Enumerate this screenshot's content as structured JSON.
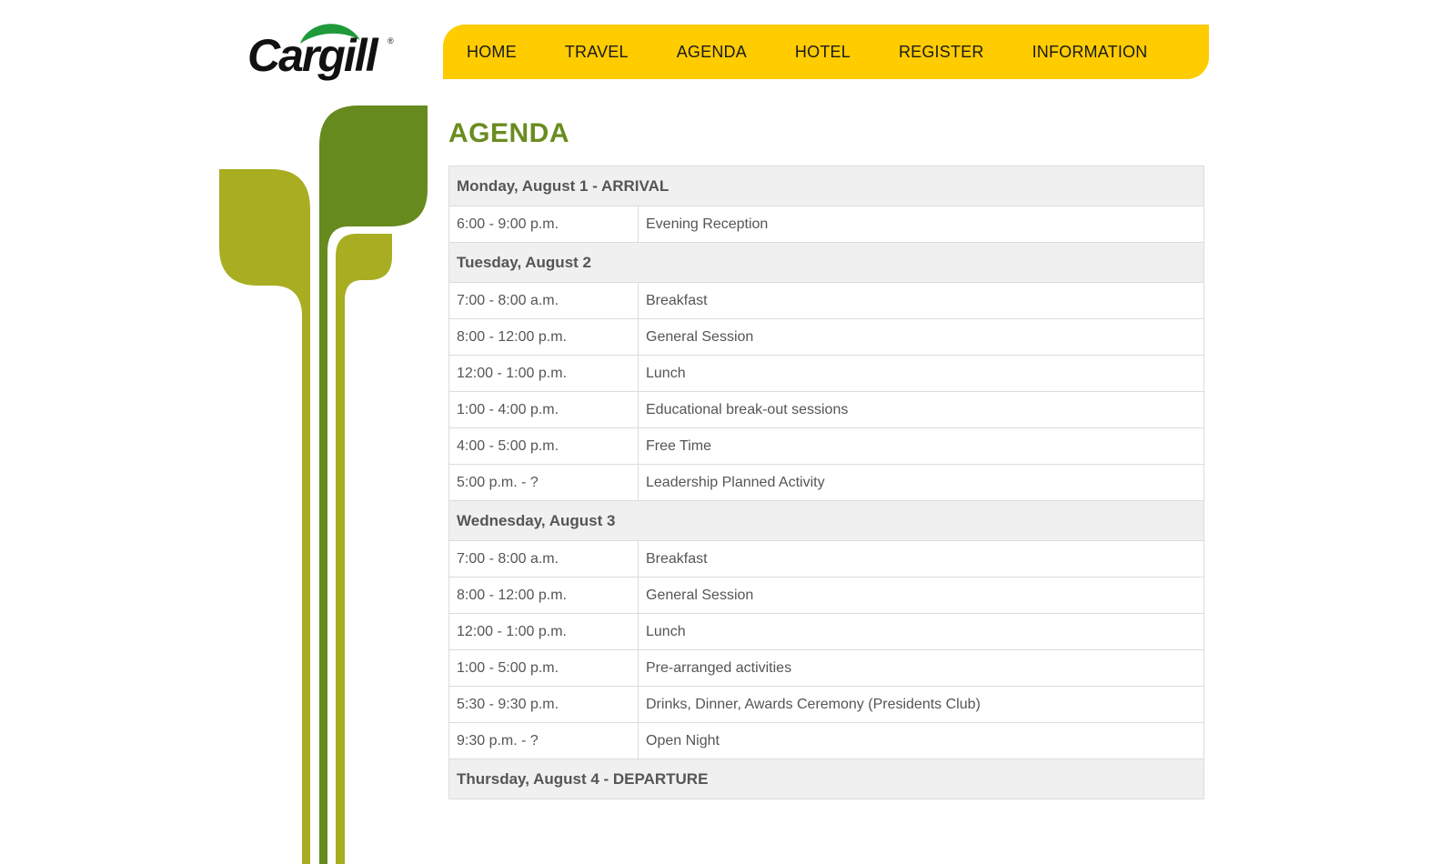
{
  "brand": {
    "logo_text": "Cargill",
    "logo_mark": "®",
    "colors": {
      "accent_yellow": "#ffcc00",
      "heading_green": "#6a8c1f",
      "leaf_olive": "#a8ad22",
      "leaf_green": "#668a1e"
    }
  },
  "nav": {
    "items": [
      {
        "label": "HOME"
      },
      {
        "label": "TRAVEL"
      },
      {
        "label": "AGENDA"
      },
      {
        "label": "HOTEL"
      },
      {
        "label": "REGISTER"
      },
      {
        "label": "INFORMATION"
      }
    ]
  },
  "main": {
    "title": "AGENDA",
    "days": [
      {
        "heading": "Monday, August 1 - ARRIVAL",
        "events": [
          {
            "time": "6:00 - 9:00 p.m.",
            "activity": "Evening Reception"
          }
        ]
      },
      {
        "heading": "Tuesday, August 2",
        "events": [
          {
            "time": "7:00 - 8:00 a.m.",
            "activity": "Breakfast"
          },
          {
            "time": "8:00 - 12:00 p.m.",
            "activity": "General Session"
          },
          {
            "time": "12:00 - 1:00 p.m.",
            "activity": "Lunch"
          },
          {
            "time": "1:00 - 4:00 p.m.",
            "activity": "Educational break-out sessions"
          },
          {
            "time": "4:00 - 5:00 p.m.",
            "activity": "Free Time"
          },
          {
            "time": "5:00 p.m. - ?",
            "activity": "Leadership Planned Activity"
          }
        ]
      },
      {
        "heading": "Wednesday, August 3",
        "events": [
          {
            "time": "7:00 - 8:00 a.m.",
            "activity": "Breakfast"
          },
          {
            "time": "8:00 - 12:00 p.m.",
            "activity": "General Session"
          },
          {
            "time": "12:00 - 1:00 p.m.",
            "activity": "Lunch"
          },
          {
            "time": "1:00 - 5:00 p.m.",
            "activity": "Pre-arranged activities"
          },
          {
            "time": "5:30 - 9:30 p.m.",
            "activity": "Drinks, Dinner, Awards Ceremony (Presidents Club)"
          },
          {
            "time": "9:30 p.m. - ?",
            "activity": "Open Night"
          }
        ]
      },
      {
        "heading": "Thursday, August 4 - DEPARTURE",
        "events": []
      }
    ]
  }
}
